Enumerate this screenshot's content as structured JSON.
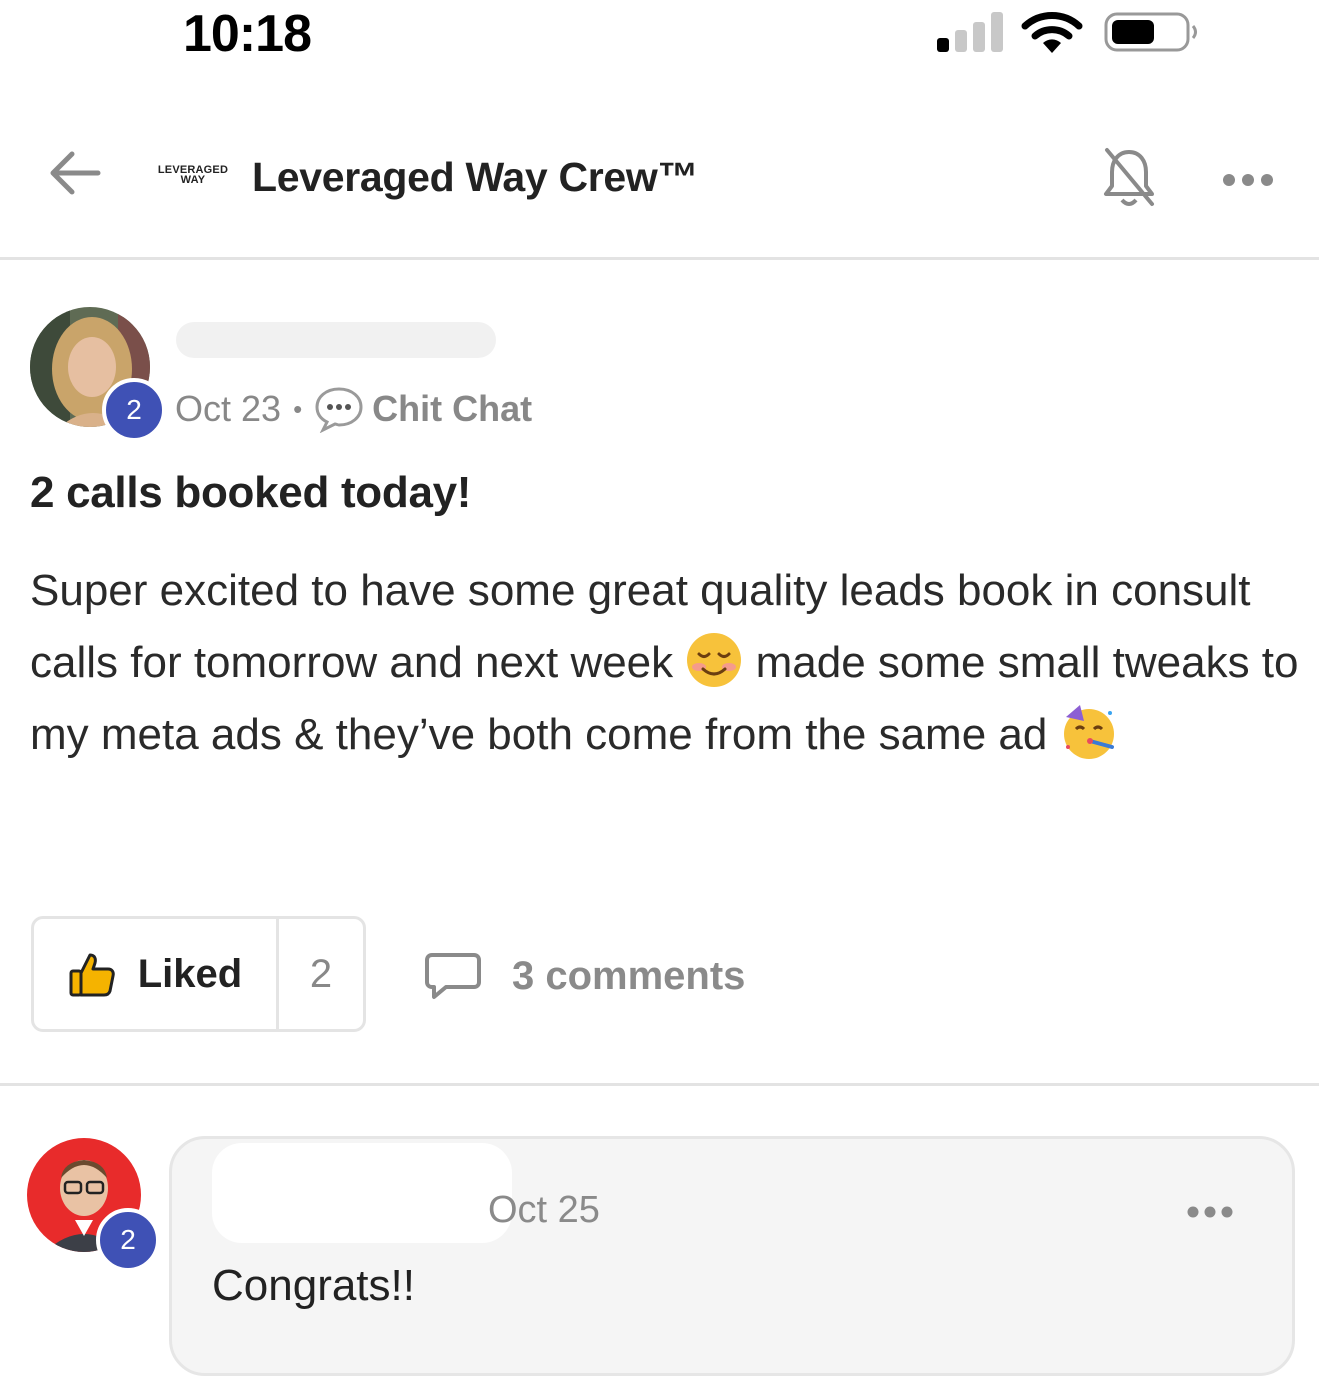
{
  "status_bar": {
    "time": "10:18"
  },
  "header": {
    "logo_line1": "LEVERAGED",
    "logo_line2": "WAY",
    "title": "Leveraged Way Crew™"
  },
  "post": {
    "author_level": "2",
    "date": "Oct 23",
    "separator": "•",
    "category": "Chit Chat",
    "title": "2 calls booked today!",
    "body_part1": "Super excited to have some great quality leads book in consult calls for tomorrow and next week ",
    "emoji1": "smiling-face-icon",
    "body_part2": " made some small tweaks to my meta ads & they’ve both come from the same ad ",
    "emoji2": "party-face-icon",
    "like_label": "Liked",
    "like_count": "2",
    "comments_label": "3 comments"
  },
  "comment": {
    "author_level": "2",
    "date": "Oct 25",
    "text": "Congrats!!"
  },
  "colors": {
    "level_badge": "#3f51b5",
    "muted_text": "#888888",
    "divider": "#e3e3e3",
    "comment_bg": "#f5f5f5",
    "like_icon": "#f5b300"
  }
}
